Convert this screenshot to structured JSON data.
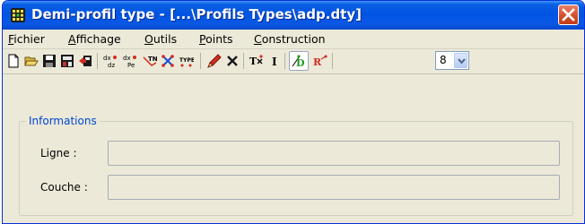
{
  "window": {
    "title": "Demi-profil type - [...\\Profils Types\\adp.dty]"
  },
  "menu": {
    "items": [
      {
        "first": "F",
        "rest": "ichier"
      },
      {
        "first": "A",
        "rest": "ffichage"
      },
      {
        "first": "O",
        "rest": "utils"
      },
      {
        "first": "P",
        "rest": "oints"
      },
      {
        "first": "C",
        "rest": "onstruction"
      }
    ]
  },
  "toolbar": {
    "icons": [
      "new-file-icon",
      "open-folder-icon",
      "save-icon",
      "save-all-icon",
      "import-icon",
      "dx-dz-icon",
      "dx-pe-icon",
      "tn-icon",
      "cross-points-icon",
      "type-icon",
      "pencil-icon",
      "delete-icon",
      "tc-icon",
      "i-icon",
      "d-point-icon",
      "r-point-icon"
    ],
    "zoom_value": "8"
  },
  "group": {
    "title": "Informations",
    "fields": [
      {
        "label": "Ligne :",
        "value": ""
      },
      {
        "label": "Couche :",
        "value": ""
      }
    ]
  },
  "colors": {
    "titlebar": "#0054e3",
    "close": "#d44f2a",
    "group_title": "#0046d5",
    "window_bg": "#ece9d8"
  }
}
